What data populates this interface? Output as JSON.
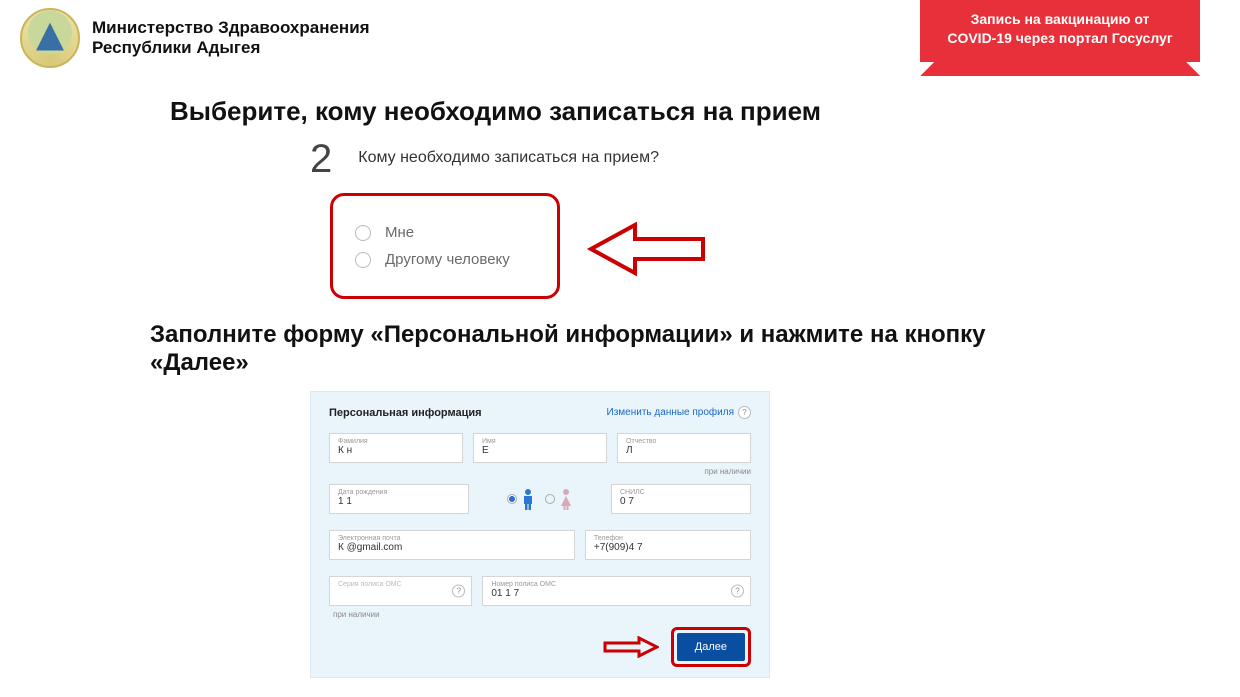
{
  "header": {
    "ministry_line1": "Министерство Здравоохранения",
    "ministry_line2": "Республики Адыгея"
  },
  "banner": {
    "line1": "Запись на вакцинацию от",
    "line2": "COVID-19 через портал Госуслуг"
  },
  "section1": {
    "title": "Выберите, кому необходимо записаться на прием",
    "step_num": "2",
    "question": "Кому необходимо записаться на прием?",
    "option_me": "Мне",
    "option_other": "Другому человеку"
  },
  "section2": {
    "title": "Заполните форму «Персональной информации» и нажмите на кнопку «Далее»"
  },
  "form": {
    "title": "Персональная информация",
    "edit_link": "Изменить данные профиля",
    "opt_note": "при наличии",
    "lastname_label": "Фамилия",
    "lastname_value": "К          н",
    "firstname_label": "Имя",
    "firstname_value": "Е",
    "patronymic_label": "Отчество",
    "patronymic_value": "Л",
    "dob_label": "Дата рождения",
    "dob_value": "1          1",
    "snils_label": "СНИЛС",
    "snils_value": "0                    7",
    "email_label": "Электронная почта",
    "email_value": "К          @gmail.com",
    "phone_label": "Телефон",
    "phone_value": "+7(909)4        7",
    "oms_series_label": "Серия полиса ОМС",
    "oms_series_value": "",
    "oms_number_label": "Номер полиса ОМС",
    "oms_number_value": "01           1                 7",
    "next_button": "Далее"
  }
}
